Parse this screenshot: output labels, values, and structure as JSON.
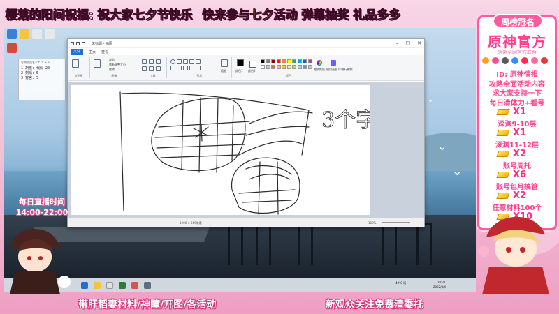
{
  "top_banner": {
    "part1": "樱落的阳间祝福: 祝大家七夕节快乐",
    "part2": "快来参与七夕活动 弹幕抽奖 礼品多多"
  },
  "side_window": {
    "title": "导购成员名 Ctrl + F",
    "lines": [
      "1.胡桃: 代码 20",
      "2.刻晴: 5",
      "3.宵宫: 5"
    ]
  },
  "paint": {
    "title": "无标题 - 画图",
    "menu_file": "文件",
    "menus": [
      "主页",
      "查看"
    ],
    "groups": [
      "剪贴板",
      "图像",
      "工具",
      "形状",
      "颜色"
    ],
    "labels": {
      "crop": "裁剪",
      "resize": "重新调整大小",
      "rotate": "旋转",
      "size": "粗细",
      "color1": "颜色1",
      "color2": "颜色2",
      "edit_colors": "编辑颜色",
      "edit_3d": "使用画图3D进行编辑"
    },
    "palette": [
      "#000000",
      "#7f7f7f",
      "#880015",
      "#ed1c24",
      "#ff7f27",
      "#fff200",
      "#22b14c",
      "#00a2e8",
      "#3f48cc",
      "#a349a4",
      "#ffffff",
      "#c3c3c3",
      "#b97a57",
      "#ffaec9",
      "#ffc90e",
      "#efe4b0",
      "#b5e61d",
      "#99d9ea",
      "#7092be",
      "#c8bfe7"
    ],
    "status_size": "1200 × 569像素",
    "zoom": "100%",
    "handwriting": "3个字"
  },
  "taskbar": {
    "weather": "40°C 晴",
    "time": "20:27",
    "date": "2022/8/4"
  },
  "right_panel": {
    "tab": "周榜冠名",
    "title": "原神官方",
    "subtitle": "感谢全网官方联合",
    "id_line": "ID: 原神情报",
    "line2": "攻略全面活动内容",
    "line3": "求大家支持一下",
    "items": [
      {
        "label": "每日清体力+看号",
        "qty": "X1"
      },
      {
        "label": "深渊9-10层",
        "qty": "X1"
      },
      {
        "label": "深渊11-12层",
        "qty": "X2"
      },
      {
        "label": "账号周托",
        "qty": "X6"
      },
      {
        "label": "账号包月搞管",
        "qty": "X2"
      },
      {
        "label": "任意材料100个",
        "qty": "X10"
      }
    ]
  },
  "schedule": {
    "title": "每日直播时间",
    "time": "14:00-22:00"
  },
  "bottom_banner": {
    "left": "带肝稻妻材料/神瞳/开图/各活动",
    "right": "新观众关注免费清委托"
  },
  "colors": {
    "accent_pink": "#ff5aa0",
    "banner_yellow": "#ffe14d",
    "paint_file_blue": "#1e6fd9"
  }
}
